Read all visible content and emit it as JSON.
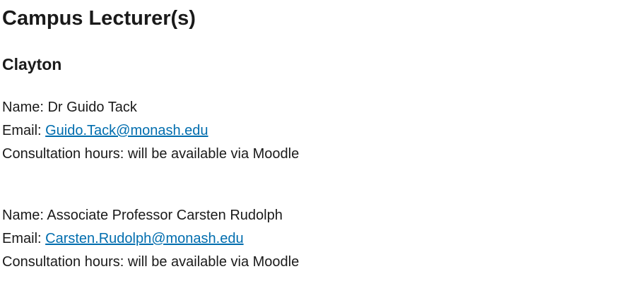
{
  "section_title": "Campus Lecturer(s)",
  "campus": "Clayton",
  "lecturers": [
    {
      "name_label": "Name: ",
      "name": "Dr Guido Tack",
      "email_label": "Email: ",
      "email": "Guido.Tack@monash.edu",
      "consultation_label": "Consultation hours: ",
      "consultation": "will be available via Moodle"
    },
    {
      "name_label": "Name: ",
      "name": "Associate Professor Carsten Rudolph",
      "email_label": "Email: ",
      "email": "Carsten.Rudolph@monash.edu",
      "consultation_label": "Consultation hours: ",
      "consultation": "will be available via Moodle"
    }
  ],
  "colors": {
    "text": "#1a1a1a",
    "link": "#006dae"
  }
}
